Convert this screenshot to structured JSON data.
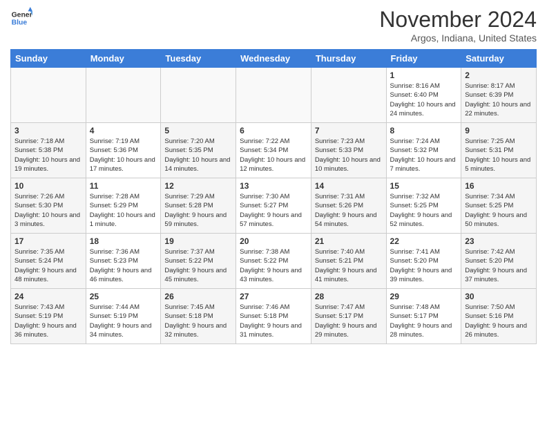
{
  "header": {
    "logo_line1": "General",
    "logo_line2": "Blue",
    "month": "November 2024",
    "location": "Argos, Indiana, United States"
  },
  "days_of_week": [
    "Sunday",
    "Monday",
    "Tuesday",
    "Wednesday",
    "Thursday",
    "Friday",
    "Saturday"
  ],
  "weeks": [
    [
      {
        "day": "",
        "sunrise": "",
        "sunset": "",
        "daylight": "",
        "empty": true
      },
      {
        "day": "",
        "sunrise": "",
        "sunset": "",
        "daylight": "",
        "empty": true
      },
      {
        "day": "",
        "sunrise": "",
        "sunset": "",
        "daylight": "",
        "empty": true
      },
      {
        "day": "",
        "sunrise": "",
        "sunset": "",
        "daylight": "",
        "empty": true
      },
      {
        "day": "",
        "sunrise": "",
        "sunset": "",
        "daylight": "",
        "empty": true
      },
      {
        "day": "1",
        "sunrise": "Sunrise: 8:16 AM",
        "sunset": "Sunset: 6:40 PM",
        "daylight": "Daylight: 10 hours and 24 minutes.",
        "empty": false
      },
      {
        "day": "2",
        "sunrise": "Sunrise: 8:17 AM",
        "sunset": "Sunset: 6:39 PM",
        "daylight": "Daylight: 10 hours and 22 minutes.",
        "empty": false
      }
    ],
    [
      {
        "day": "3",
        "sunrise": "Sunrise: 7:18 AM",
        "sunset": "Sunset: 5:38 PM",
        "daylight": "Daylight: 10 hours and 19 minutes.",
        "empty": false
      },
      {
        "day": "4",
        "sunrise": "Sunrise: 7:19 AM",
        "sunset": "Sunset: 5:36 PM",
        "daylight": "Daylight: 10 hours and 17 minutes.",
        "empty": false
      },
      {
        "day": "5",
        "sunrise": "Sunrise: 7:20 AM",
        "sunset": "Sunset: 5:35 PM",
        "daylight": "Daylight: 10 hours and 14 minutes.",
        "empty": false
      },
      {
        "day": "6",
        "sunrise": "Sunrise: 7:22 AM",
        "sunset": "Sunset: 5:34 PM",
        "daylight": "Daylight: 10 hours and 12 minutes.",
        "empty": false
      },
      {
        "day": "7",
        "sunrise": "Sunrise: 7:23 AM",
        "sunset": "Sunset: 5:33 PM",
        "daylight": "Daylight: 10 hours and 10 minutes.",
        "empty": false
      },
      {
        "day": "8",
        "sunrise": "Sunrise: 7:24 AM",
        "sunset": "Sunset: 5:32 PM",
        "daylight": "Daylight: 10 hours and 7 minutes.",
        "empty": false
      },
      {
        "day": "9",
        "sunrise": "Sunrise: 7:25 AM",
        "sunset": "Sunset: 5:31 PM",
        "daylight": "Daylight: 10 hours and 5 minutes.",
        "empty": false
      }
    ],
    [
      {
        "day": "10",
        "sunrise": "Sunrise: 7:26 AM",
        "sunset": "Sunset: 5:30 PM",
        "daylight": "Daylight: 10 hours and 3 minutes.",
        "empty": false
      },
      {
        "day": "11",
        "sunrise": "Sunrise: 7:28 AM",
        "sunset": "Sunset: 5:29 PM",
        "daylight": "Daylight: 10 hours and 1 minute.",
        "empty": false
      },
      {
        "day": "12",
        "sunrise": "Sunrise: 7:29 AM",
        "sunset": "Sunset: 5:28 PM",
        "daylight": "Daylight: 9 hours and 59 minutes.",
        "empty": false
      },
      {
        "day": "13",
        "sunrise": "Sunrise: 7:30 AM",
        "sunset": "Sunset: 5:27 PM",
        "daylight": "Daylight: 9 hours and 57 minutes.",
        "empty": false
      },
      {
        "day": "14",
        "sunrise": "Sunrise: 7:31 AM",
        "sunset": "Sunset: 5:26 PM",
        "daylight": "Daylight: 9 hours and 54 minutes.",
        "empty": false
      },
      {
        "day": "15",
        "sunrise": "Sunrise: 7:32 AM",
        "sunset": "Sunset: 5:25 PM",
        "daylight": "Daylight: 9 hours and 52 minutes.",
        "empty": false
      },
      {
        "day": "16",
        "sunrise": "Sunrise: 7:34 AM",
        "sunset": "Sunset: 5:25 PM",
        "daylight": "Daylight: 9 hours and 50 minutes.",
        "empty": false
      }
    ],
    [
      {
        "day": "17",
        "sunrise": "Sunrise: 7:35 AM",
        "sunset": "Sunset: 5:24 PM",
        "daylight": "Daylight: 9 hours and 48 minutes.",
        "empty": false
      },
      {
        "day": "18",
        "sunrise": "Sunrise: 7:36 AM",
        "sunset": "Sunset: 5:23 PM",
        "daylight": "Daylight: 9 hours and 46 minutes.",
        "empty": false
      },
      {
        "day": "19",
        "sunrise": "Sunrise: 7:37 AM",
        "sunset": "Sunset: 5:22 PM",
        "daylight": "Daylight: 9 hours and 45 minutes.",
        "empty": false
      },
      {
        "day": "20",
        "sunrise": "Sunrise: 7:38 AM",
        "sunset": "Sunset: 5:22 PM",
        "daylight": "Daylight: 9 hours and 43 minutes.",
        "empty": false
      },
      {
        "day": "21",
        "sunrise": "Sunrise: 7:40 AM",
        "sunset": "Sunset: 5:21 PM",
        "daylight": "Daylight: 9 hours and 41 minutes.",
        "empty": false
      },
      {
        "day": "22",
        "sunrise": "Sunrise: 7:41 AM",
        "sunset": "Sunset: 5:20 PM",
        "daylight": "Daylight: 9 hours and 39 minutes.",
        "empty": false
      },
      {
        "day": "23",
        "sunrise": "Sunrise: 7:42 AM",
        "sunset": "Sunset: 5:20 PM",
        "daylight": "Daylight: 9 hours and 37 minutes.",
        "empty": false
      }
    ],
    [
      {
        "day": "24",
        "sunrise": "Sunrise: 7:43 AM",
        "sunset": "Sunset: 5:19 PM",
        "daylight": "Daylight: 9 hours and 36 minutes.",
        "empty": false
      },
      {
        "day": "25",
        "sunrise": "Sunrise: 7:44 AM",
        "sunset": "Sunset: 5:19 PM",
        "daylight": "Daylight: 9 hours and 34 minutes.",
        "empty": false
      },
      {
        "day": "26",
        "sunrise": "Sunrise: 7:45 AM",
        "sunset": "Sunset: 5:18 PM",
        "daylight": "Daylight: 9 hours and 32 minutes.",
        "empty": false
      },
      {
        "day": "27",
        "sunrise": "Sunrise: 7:46 AM",
        "sunset": "Sunset: 5:18 PM",
        "daylight": "Daylight: 9 hours and 31 minutes.",
        "empty": false
      },
      {
        "day": "28",
        "sunrise": "Sunrise: 7:47 AM",
        "sunset": "Sunset: 5:17 PM",
        "daylight": "Daylight: 9 hours and 29 minutes.",
        "empty": false
      },
      {
        "day": "29",
        "sunrise": "Sunrise: 7:48 AM",
        "sunset": "Sunset: 5:17 PM",
        "daylight": "Daylight: 9 hours and 28 minutes.",
        "empty": false
      },
      {
        "day": "30",
        "sunrise": "Sunrise: 7:50 AM",
        "sunset": "Sunset: 5:16 PM",
        "daylight": "Daylight: 9 hours and 26 minutes.",
        "empty": false
      }
    ]
  ]
}
